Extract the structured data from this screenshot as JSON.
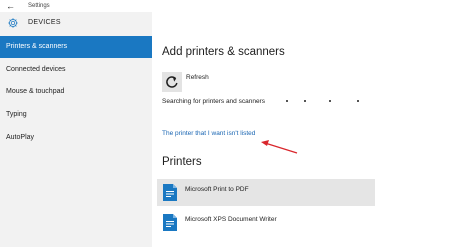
{
  "window": {
    "title": "Settings"
  },
  "sidebar": {
    "header_label": "DEVICES",
    "items": [
      {
        "label": "Printers & scanners",
        "active": true
      },
      {
        "label": "Connected devices",
        "active": false
      },
      {
        "label": "Mouse & touchpad",
        "active": false
      },
      {
        "label": "Typing",
        "active": false
      },
      {
        "label": "AutoPlay",
        "active": false
      }
    ]
  },
  "main": {
    "add_section_title": "Add printers & scanners",
    "refresh_label": "Refresh",
    "searching_text": "Searching for printers and scanners",
    "not_listed_link": "The printer that I want isn't listed",
    "printers_section_title": "Printers",
    "printers": [
      {
        "label": "Microsoft Print to PDF",
        "selected": true,
        "icon": "document-printer-icon"
      },
      {
        "label": "Microsoft XPS Document Writer",
        "selected": false,
        "icon": "document-printer-icon"
      }
    ]
  },
  "colors": {
    "accent": "#1a78c2",
    "link": "#1a66b3",
    "annotation_arrow": "#d9262c",
    "sidebar_bg": "#f2f2f2",
    "selected_bg": "#e5e5e5"
  }
}
